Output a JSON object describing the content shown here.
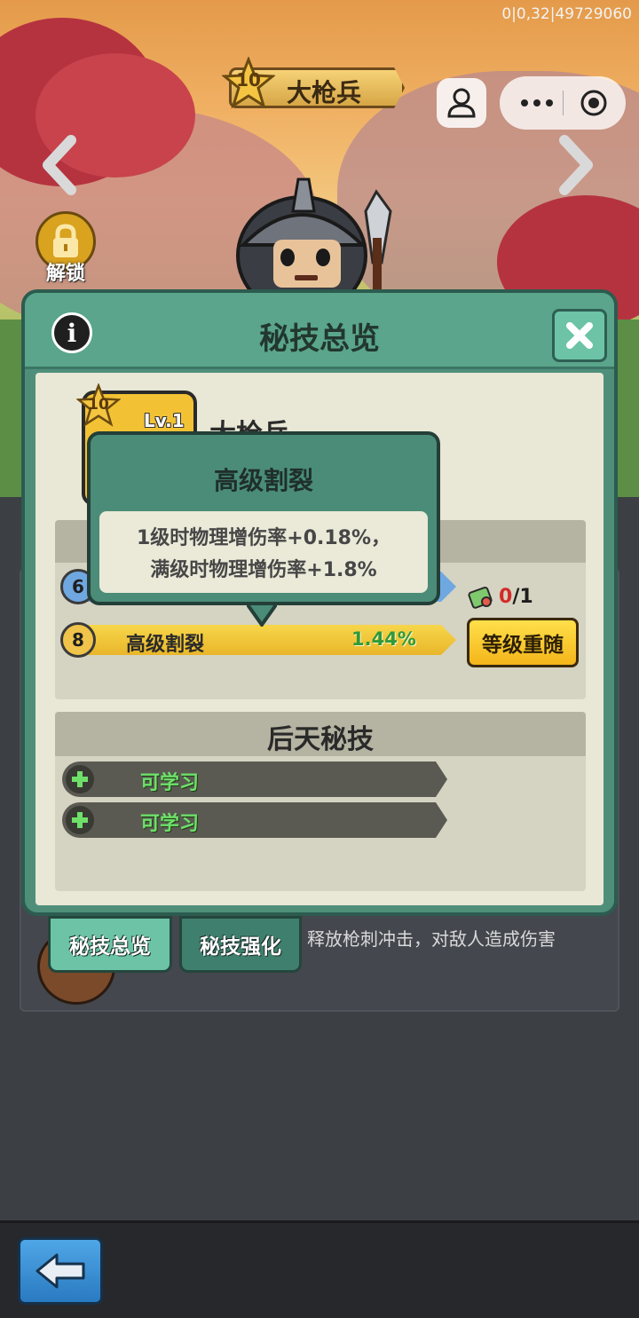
{
  "status": {
    "debug_text": "0|0,32|49729060"
  },
  "hud": {
    "hero_star_level": "10",
    "hero_name": "大枪兵",
    "lock_label": "解锁"
  },
  "modal": {
    "title": "秘技总览",
    "info_glyph": "i",
    "hero_card": {
      "star_level": "10",
      "level": "Lv.1",
      "name": "大枪兵"
    },
    "innate_skills": [
      {
        "number": "6",
        "label": "",
        "value": ""
      },
      {
        "number": "8",
        "label": "高级割裂",
        "value": "1.44%"
      }
    ],
    "reroll": {
      "count_used": "0",
      "count_total": "/1",
      "button_label": "等级重随"
    },
    "acquired_section": {
      "title": "后天秘技",
      "slots": [
        {
          "label": "可学习"
        },
        {
          "label": "可学习"
        }
      ]
    }
  },
  "tooltip": {
    "title": "高级割裂",
    "line1": "1级时物理增伤率+0.18%，",
    "line2": "满级时物理增伤率+1.8%"
  },
  "tabs": [
    {
      "label": "秘技总览",
      "active": true
    },
    {
      "label": "秘技强化",
      "active": false
    }
  ],
  "skill_description": "释放枪刺冲击，对敌人造成伤害",
  "colors": {
    "modal_green": "#4f8f7a",
    "header_green": "#5aa58b",
    "gold": "#f2c234",
    "learn_green": "#6ee06a"
  }
}
